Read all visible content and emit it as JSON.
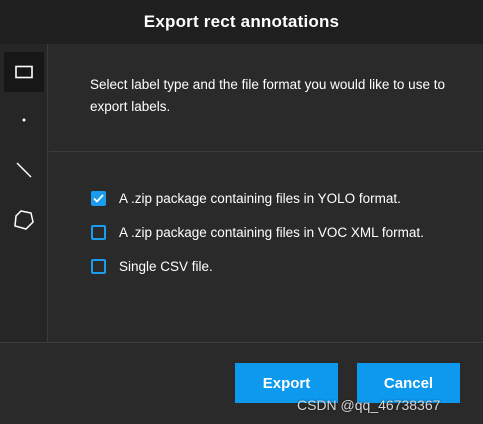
{
  "dialog": {
    "title": "Export rect annotations",
    "description": "Select label type and the file format you would like to use to export labels."
  },
  "toolbar": {
    "tools": [
      {
        "name": "rect-tool",
        "icon": "rectangle-icon",
        "active": true
      },
      {
        "name": "point-tool",
        "icon": "point-icon",
        "active": false
      },
      {
        "name": "line-tool",
        "icon": "line-icon",
        "active": false
      },
      {
        "name": "polygon-tool",
        "icon": "polygon-icon",
        "active": false
      }
    ]
  },
  "options": [
    {
      "label": "A .zip package containing files in YOLO format.",
      "checked": true
    },
    {
      "label": "A .zip package containing files in VOC XML format.",
      "checked": false
    },
    {
      "label": "Single CSV file.",
      "checked": false
    }
  ],
  "buttons": {
    "export_label": "Export",
    "cancel_label": "Cancel"
  },
  "watermark": "CSDN @qq_46738367",
  "colors": {
    "accent": "#0d99ee",
    "checkbox": "#1a9cf0",
    "background": "#2a2a2a",
    "header": "#1f1f1f"
  }
}
